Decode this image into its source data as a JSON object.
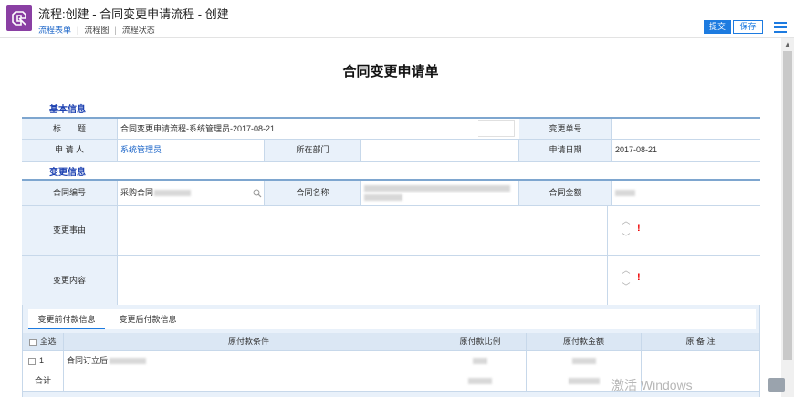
{
  "header": {
    "title": "流程:创建 - 合同变更申请流程 - 创建",
    "tabs": [
      "流程表单",
      "流程图",
      "流程状态"
    ],
    "submit_label": "提交",
    "save_label": "保存"
  },
  "form": {
    "title": "合同变更申请单",
    "basic_section": "基本信息",
    "basic": {
      "subject_label": "标　　题",
      "subject_value": "合同变更申请流程-系统管理员-2017-08-21",
      "change_no_label": "变更单号",
      "change_no_value": "",
      "applicant_label": "申 请 人",
      "applicant_value": "系统管理员",
      "dept_label": "所在部门",
      "dept_value": "",
      "date_label": "申请日期",
      "date_value": "2017-08-21"
    },
    "change_section": "变更信息",
    "change": {
      "contract_no_label": "合同编号",
      "contract_no_value": "采购合同",
      "contract_name_label": "合同名称",
      "contract_amount_label": "合同金额",
      "reason_label": "变更事由",
      "content_label": "变更内容",
      "required_mark": "!",
      "spin_up": "︿",
      "spin_down": "﹀"
    },
    "payment_tabs": [
      "变更前付款信息",
      "变更后付款信息"
    ],
    "payment_table": {
      "select_all": "全选",
      "headers": [
        "原付款条件",
        "原付款比例",
        "原付款金额",
        "原 备 注"
      ],
      "rows": [
        {
          "index": "1",
          "condition": "合同订立后"
        }
      ],
      "total_label": "合计"
    }
  },
  "watermark": "激活 Windows"
}
